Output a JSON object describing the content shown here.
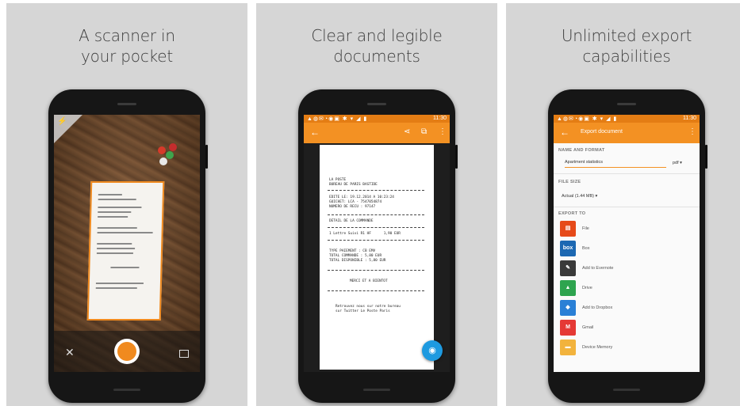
{
  "panels": [
    {
      "caption_line1": "A scanner in",
      "caption_line2": "your pocket"
    },
    {
      "caption_line1": "Clear and legible",
      "caption_line2": "documents"
    },
    {
      "caption_line1": "Unlimited export",
      "caption_line2": "capabilities"
    }
  ],
  "colors": {
    "accent": "#f39123",
    "status_bar": "#e47d14",
    "fab": "#1e9ae0",
    "panel_bg": "#d6d6d6"
  },
  "status": {
    "time": "11:30"
  },
  "scan_screen": {
    "icons": [
      "close-icon",
      "shutter-button",
      "gallery-icon"
    ]
  },
  "document_screen": {
    "lines": [
      "LA POSTE",
      "BUREAU DE PARIS BASTIDE",
      "EDITE LE: 19.12.2014 A 10:23:24",
      "GUICHET: LCA - 7547054874",
      "NUMERO DE RECU : 97147",
      "DETAIL DE LA COMMANDE",
      "1 Lettre Suivi R1 HF      1,90 EUR",
      "TYPE PAIEMENT : CB EMV",
      "TOTAL COMMANDE : 5,80 EUR",
      "TOTAL DISPONIBLE : 5,80 EUR",
      "MERCI ET A BIENTOT",
      "Retrouvez nous sur notre bureau",
      "sur Twitter Le Poste Paris"
    ]
  },
  "export_screen": {
    "title": "Export document",
    "name_and_format_label": "NAME AND FORMAT",
    "file_name": "Apartment statistics",
    "format": "pdf",
    "file_size_label": "FILE SIZE",
    "file_size_value": "Actual (1.44 MB)",
    "export_to_label": "EXPORT TO",
    "services": [
      {
        "label": "File",
        "icon": "file-icon",
        "color": "#e64a19",
        "glyph": "▤"
      },
      {
        "label": "Box",
        "icon": "box-icon",
        "color": "#1c68b2",
        "glyph": "box"
      },
      {
        "label": "Add to Evernote",
        "icon": "evernote-icon",
        "color": "#3a3a3a",
        "glyph": "✎"
      },
      {
        "label": "Drive",
        "icon": "drive-icon",
        "color": "#2ea44f",
        "glyph": "▲"
      },
      {
        "label": "Add to Dropbox",
        "icon": "dropbox-icon",
        "color": "#2a80d6",
        "glyph": "◆"
      },
      {
        "label": "Gmail",
        "icon": "gmail-icon",
        "color": "#e53935",
        "glyph": "M"
      },
      {
        "label": "Device Memory",
        "icon": "folder-icon",
        "color": "#f2b33d",
        "glyph": "▬"
      }
    ]
  }
}
